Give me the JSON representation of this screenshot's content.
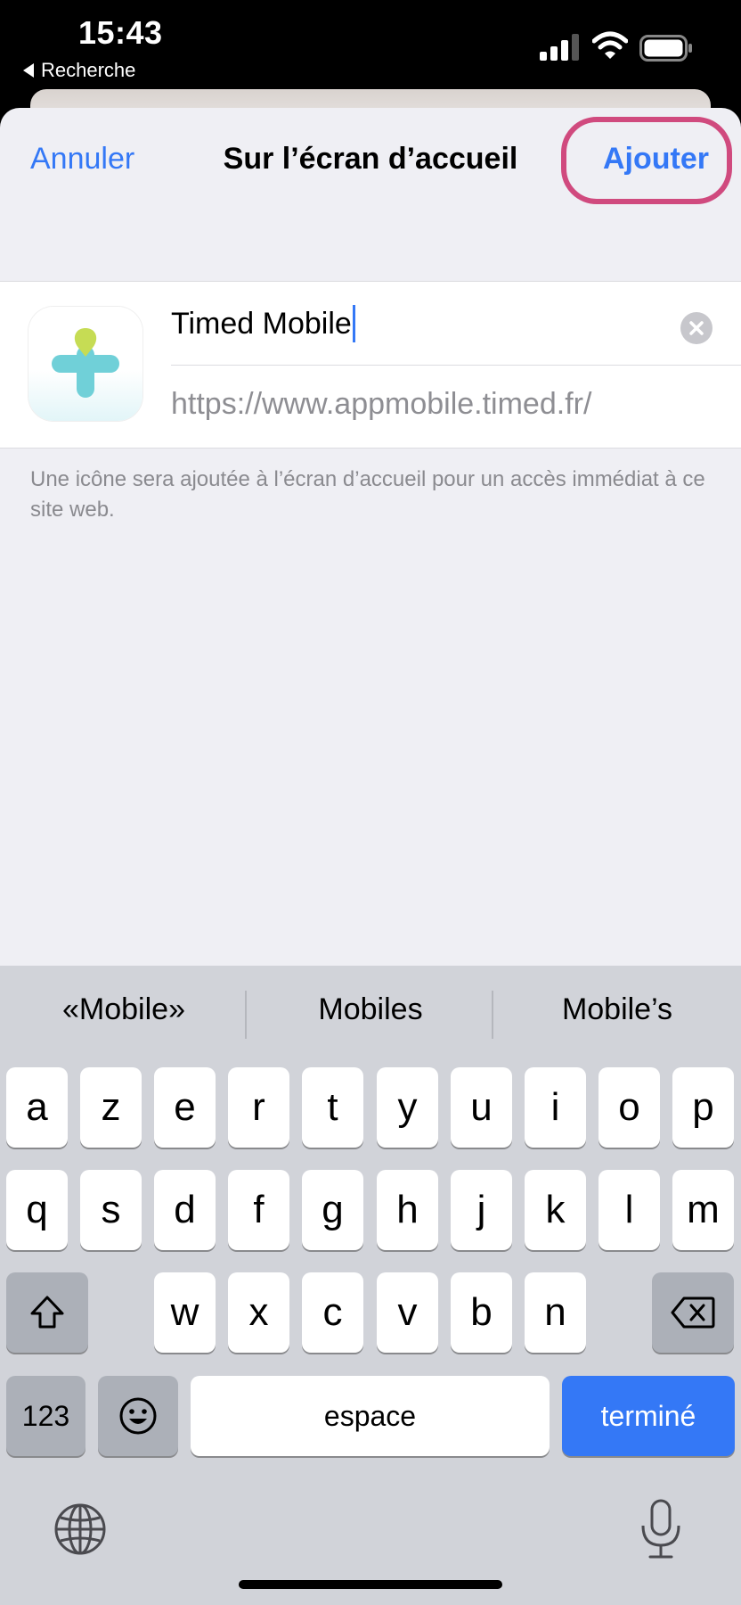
{
  "status_bar": {
    "time": "15:43",
    "back_app": "Recherche",
    "icons": [
      "cellular-signal-icon",
      "wifi-icon",
      "battery-icon"
    ]
  },
  "nav": {
    "cancel": "Annuler",
    "title": "Sur l’écran d’accueil",
    "add": "Ajouter"
  },
  "form": {
    "name_value": "Timed Mobile",
    "url": "https://www.appmobile.timed.fr/",
    "hint": "Une icône sera ajoutée à l’écran d’accueil pour un accès immédiat à ce site web."
  },
  "keyboard": {
    "suggestions": [
      "«Mobile»",
      "Mobiles",
      "Mobile’s"
    ],
    "row1": [
      "a",
      "z",
      "e",
      "r",
      "t",
      "y",
      "u",
      "i",
      "o",
      "p"
    ],
    "row2": [
      "q",
      "s",
      "d",
      "f",
      "g",
      "h",
      "j",
      "k",
      "l",
      "m"
    ],
    "row3": [
      "w",
      "x",
      "c",
      "v",
      "b",
      "n"
    ],
    "numbers": "123",
    "space": "espace",
    "done": "terminé"
  },
  "colors": {
    "accent": "#3478f6",
    "highlight": "#d04a7e",
    "sheet_bg": "#efeff4",
    "keyboard_bg": "#d1d3d9"
  }
}
